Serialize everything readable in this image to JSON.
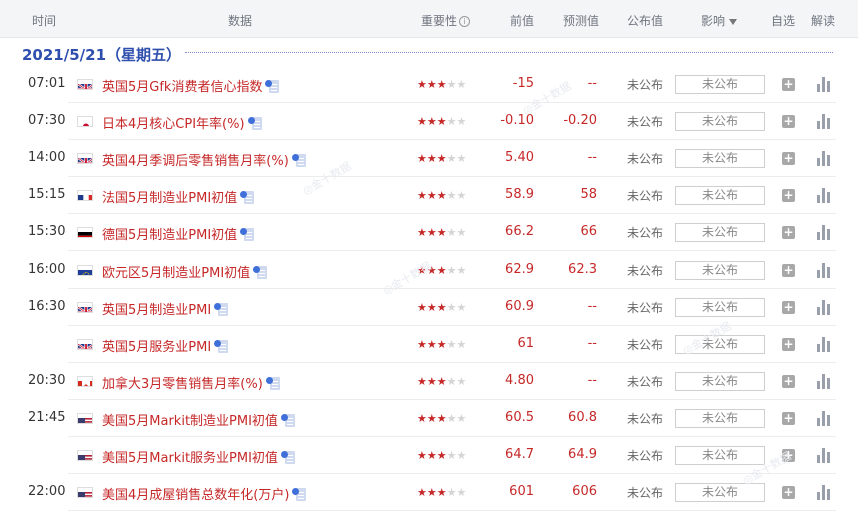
{
  "header": {
    "time": "时间",
    "data": "数据",
    "importance": "重要性",
    "importance_info": "i",
    "prev": "前值",
    "forecast": "预测值",
    "published": "公布值",
    "impact": "影响",
    "watch": "自选",
    "explain": "解读"
  },
  "date": "2021/5/21（星期五）",
  "colors": {
    "accent": "#2f4fae",
    "red": "#c62828"
  },
  "rows": [
    {
      "time": "07:01",
      "flag": "gb-flag-icon",
      "name": "英国5月Gfk消费者信心指数",
      "stars": 3,
      "star_on": "★★★",
      "star_off": "★★",
      "prev": "-15",
      "forecast": "--",
      "published": "未公布",
      "impact": "未公布"
    },
    {
      "time": "07:30",
      "flag": "jp-flag-icon",
      "name": "日本4月核心CPI年率(%)",
      "stars": 3,
      "star_on": "★★★",
      "star_off": "★★",
      "prev": "-0.10",
      "forecast": "-0.20",
      "published": "未公布",
      "impact": "未公布"
    },
    {
      "time": "14:00",
      "flag": "gb-flag-icon",
      "name": "英国4月季调后零售销售月率(%)",
      "stars": 3,
      "star_on": "★★★",
      "star_off": "★★",
      "prev": "5.40",
      "forecast": "--",
      "published": "未公布",
      "impact": "未公布"
    },
    {
      "time": "15:15",
      "flag": "fr-flag-icon",
      "name": "法国5月制造业PMI初值",
      "stars": 3,
      "star_on": "★★★",
      "star_off": "★★",
      "prev": "58.9",
      "forecast": "58",
      "published": "未公布",
      "impact": "未公布"
    },
    {
      "time": "15:30",
      "flag": "de-flag-icon",
      "name": "德国5月制造业PMI初值",
      "stars": 3,
      "star_on": "★★★",
      "star_off": "★★",
      "prev": "66.2",
      "forecast": "66",
      "published": "未公布",
      "impact": "未公布"
    },
    {
      "time": "16:00",
      "flag": "eu-flag-icon",
      "name": "欧元区5月制造业PMI初值",
      "stars": 3,
      "star_on": "★★★",
      "star_off": "★★",
      "prev": "62.9",
      "forecast": "62.3",
      "published": "未公布",
      "impact": "未公布"
    },
    {
      "time": "16:30",
      "flag": "gb-flag-icon",
      "name": "英国5月制造业PMI",
      "stars": 3,
      "star_on": "★★★",
      "star_off": "★★",
      "prev": "60.9",
      "forecast": "--",
      "published": "未公布",
      "impact": "未公布"
    },
    {
      "time": "",
      "flag": "gb-flag-icon",
      "name": "英国5月服务业PMI",
      "stars": 3,
      "star_on": "★★★",
      "star_off": "★★",
      "prev": "61",
      "forecast": "--",
      "published": "未公布",
      "impact": "未公布"
    },
    {
      "time": "20:30",
      "flag": "ca-flag-icon",
      "name": "加拿大3月零售销售月率(%)",
      "stars": 3,
      "star_on": "★★★",
      "star_off": "★★",
      "prev": "4.80",
      "forecast": "--",
      "published": "未公布",
      "impact": "未公布"
    },
    {
      "time": "21:45",
      "flag": "us-flag-icon",
      "name": "美国5月Markit制造业PMI初值",
      "stars": 3,
      "star_on": "★★★",
      "star_off": "★★",
      "prev": "60.5",
      "forecast": "60.8",
      "published": "未公布",
      "impact": "未公布"
    },
    {
      "time": "",
      "flag": "us-flag-icon",
      "name": "美国5月Markit服务业PMI初值",
      "stars": 3,
      "star_on": "★★★",
      "star_off": "★★",
      "prev": "64.7",
      "forecast": "64.9",
      "published": "未公布",
      "impact": "未公布"
    },
    {
      "time": "22:00",
      "flag": "us-flag-icon",
      "name": "美国4月成屋销售总数年化(万户)",
      "stars": 3,
      "star_on": "★★★",
      "star_off": "★★",
      "prev": "601",
      "forecast": "606",
      "published": "未公布",
      "impact": "未公布"
    }
  ],
  "add_label": "+"
}
